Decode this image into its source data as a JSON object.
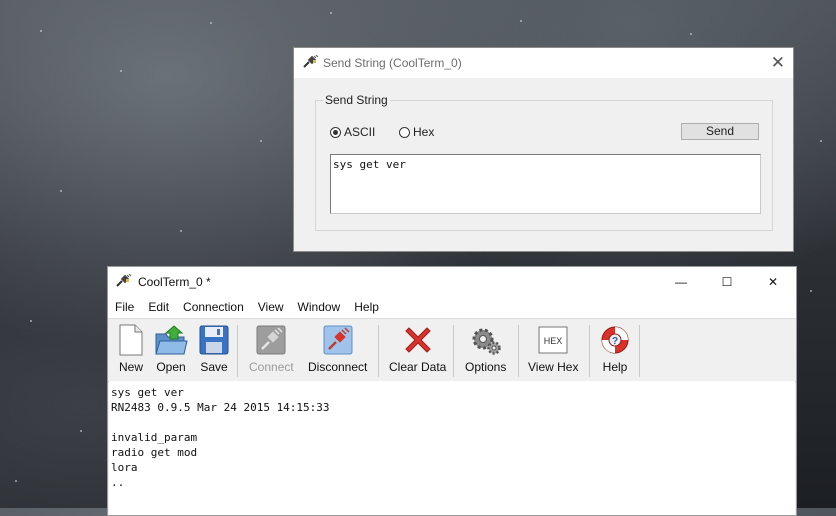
{
  "send_dialog": {
    "title": "Send String (CoolTerm_0)",
    "close_glyph": "✕",
    "group_label": "Send String",
    "mode_ascii": "ASCII",
    "mode_hex": "Hex",
    "selected_mode": "ASCII",
    "send_label": "Send",
    "input_value": "sys get ver"
  },
  "main_window": {
    "title": "CoolTerm_0 *",
    "controls": {
      "minimize": "—",
      "maximize": "☐",
      "close": "✕"
    },
    "menu": [
      "File",
      "Edit",
      "Connection",
      "View",
      "Window",
      "Help"
    ],
    "toolbar": {
      "new": "New",
      "open": "Open",
      "save": "Save",
      "connect": "Connect",
      "disconnect": "Disconnect",
      "clear_data": "Clear Data",
      "options": "Options",
      "view_hex": "View Hex",
      "help": "Help"
    },
    "hex_icon_text": "HEX",
    "terminal_lines": [
      "sys get ver",
      "RN2483 0.9.5 Mar 24 2015 14:15:33",
      "",
      "invalid_param",
      "radio get mod",
      "lora",
      ".."
    ]
  },
  "icons": [
    "cable-plug-icon",
    "new-file-icon",
    "open-folder-icon",
    "floppy-save-icon",
    "connect-plug-icon",
    "disconnect-plug-icon",
    "red-x-icon",
    "gears-icon",
    "hex-view-icon",
    "lifebuoy-icon"
  ],
  "colors": {
    "accent_red": "#d8322b",
    "disabled_text": "#9b9b9b",
    "toolbar_bg": "#f0f0f0"
  }
}
